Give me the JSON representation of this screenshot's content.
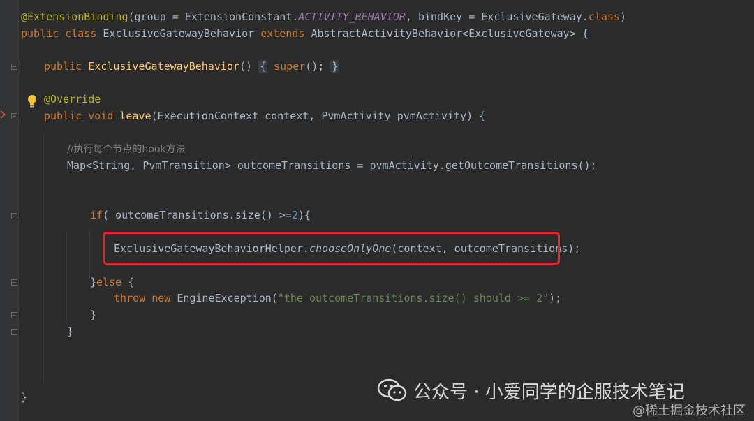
{
  "editor": {
    "language": "java",
    "lines": {
      "l1": {
        "annotation": "@ExtensionBinding",
        "t1": "(group = ExtensionConstant.",
        "const": "ACTIVITY_BEHAVIOR",
        "t2": ", bindKey = ExclusiveGateway.",
        "kw_class": "class",
        "t3": ")"
      },
      "l2": {
        "kw_public": "public",
        "kw_class": "class",
        "name": "ExclusiveGatewayBehavior",
        "kw_extends": "extends",
        "t1": "AbstractActivityBehavior<ExclusiveGateway> {"
      },
      "l3": {
        "kw_public": "public",
        "ctor": "ExclusiveGatewayBehavior",
        "t1": "()",
        "brace_open": "{",
        "kw_super": "super",
        "t2": "();",
        "brace_close": "}"
      },
      "l4": {
        "annotation": "@Override"
      },
      "l5": {
        "kw_public": "public",
        "kw_void": "void",
        "method": "leave",
        "t1": "(ExecutionContext context, PvmActivity pvmActivity) {"
      },
      "l6": {
        "comment": "//执行每个节点的hook方法"
      },
      "l7": {
        "t1": "Map<String, PvmTransition> outcomeTransitions = pvmActivity.getOutcomeTransitions();"
      },
      "l8": {
        "kw_if": "if",
        "t1": "( outcomeTransitions.size() >=",
        "num": "2",
        "t2": "){"
      },
      "l9": {
        "t1": "ExclusiveGatewayBehaviorHelper.",
        "method": "chooseOnlyOne",
        "t2": "(context, outcomeTransitions);"
      },
      "l10": {
        "t1": "}",
        "kw_else": "else",
        "t2": "{"
      },
      "l11": {
        "kw_throw": "throw",
        "kw_new": "new",
        "t1": "EngineException(",
        "str": "\"the outcomeTransitions.size() should >= 2\"",
        "t2": ");"
      },
      "l12": {
        "t1": "}"
      },
      "l13": {
        "t1": "}"
      },
      "l14": {
        "t1": "}"
      }
    }
  },
  "watermark": {
    "main": "公众号 · 小爱同学的企服技术笔记",
    "site": "@稀土掘金技术社区",
    "icon": "wechat-icon"
  },
  "colors": {
    "background": "#2b2b2b",
    "keyword": "#cc7832",
    "annotation": "#bbb529",
    "method": "#ffc66d",
    "string": "#6a8759",
    "number": "#6897bb",
    "highlight_box": "#e3262a"
  }
}
